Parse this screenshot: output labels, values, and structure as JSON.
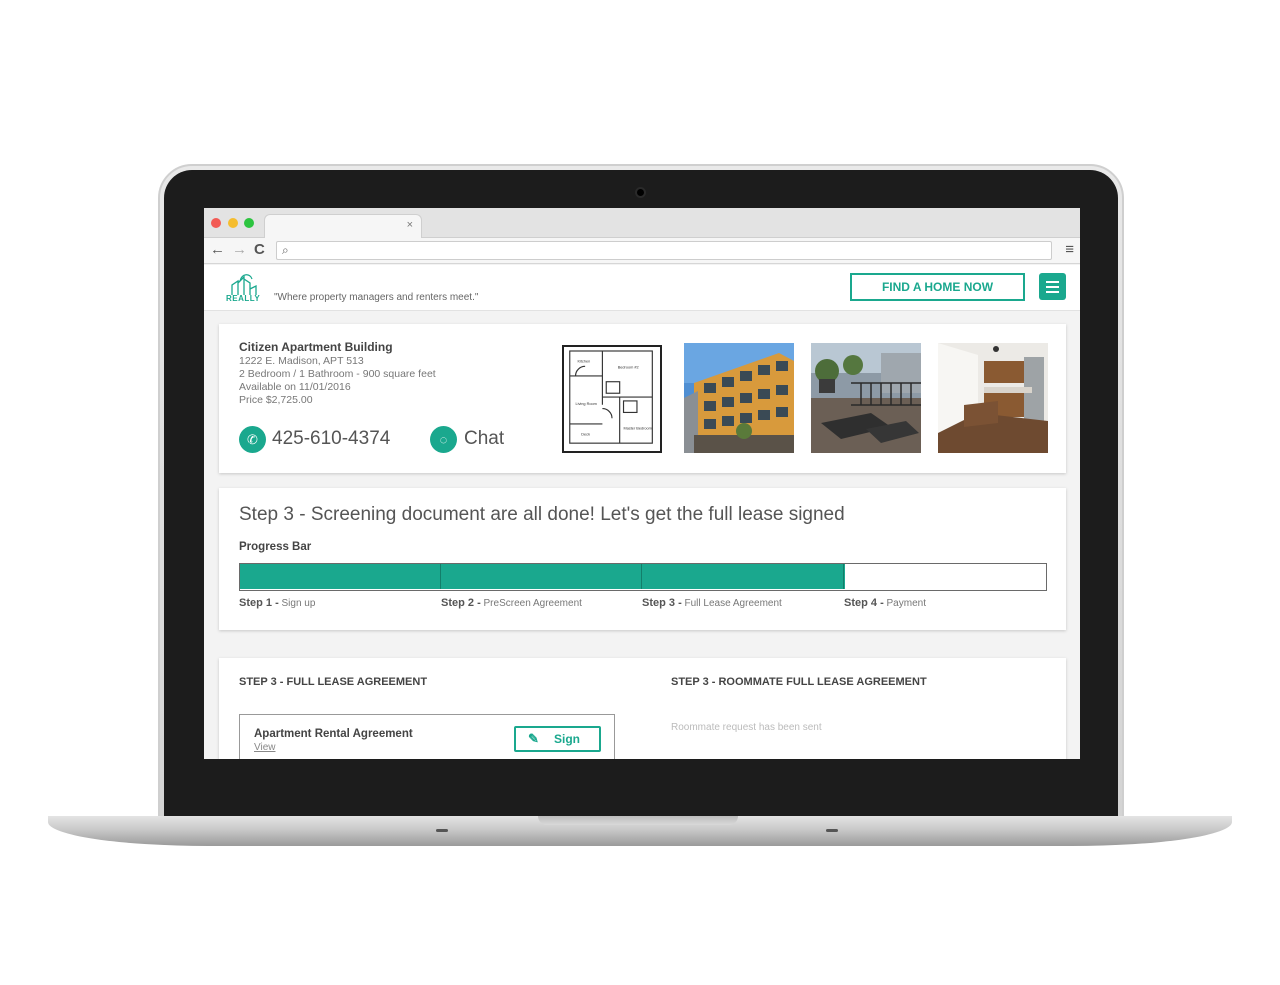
{
  "browser": {
    "tab_close": "×",
    "back_icon": "←",
    "forward_icon": "→",
    "reload_icon": "C",
    "search_glyph": "🔍",
    "menu_icon": "≡",
    "url": ""
  },
  "header": {
    "logo_text": "REALLY",
    "tagline": "\"Where property managers and renters meet.\"",
    "find_home_label": "FIND A HOME NOW",
    "accent_color": "#1aa88e"
  },
  "listing": {
    "name": "Citizen Apartment Building",
    "address": "1222 E. Madison, APT 513",
    "rooms": "2 Bedroom / 1 Bathroom - 900 square feet",
    "available": "Available on 11/01/2016",
    "price": "Price $2,725.00",
    "phone": "425-610-4374",
    "chat_label": "Chat",
    "phone_icon": "phone-icon",
    "chat_icon": "chat-bubble-icon"
  },
  "progress": {
    "title": "Step 3 - Screening document are all done! Let's get the full lease signed",
    "bar_label": "Progress Bar",
    "completed_fraction": 0.75,
    "steps": [
      {
        "num": "Step 1 -",
        "name": "Sign up"
      },
      {
        "num": "Step 2 -",
        "name": "PreScreen Agreement"
      },
      {
        "num": "Step 3 -",
        "name": "Full Lease Agreement"
      },
      {
        "num": "Step 4 -",
        "name": "Payment"
      }
    ]
  },
  "lease": {
    "left_heading": "STEP 3 - FULL LEASE AGREEMENT",
    "right_heading": "STEP 3 - ROOMMATE FULL LEASE AGREEMENT",
    "agreement_title": "Apartment Rental Agreement",
    "view_label": "View",
    "sign_label": "Sign",
    "roommate_note": "Roommate request has been sent"
  }
}
